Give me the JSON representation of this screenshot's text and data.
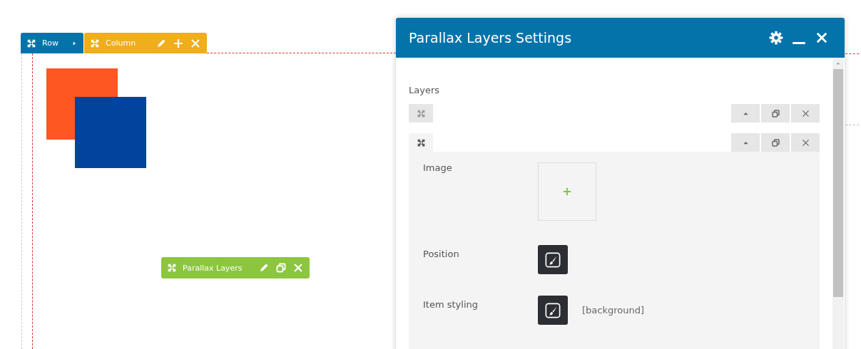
{
  "canvas": {
    "toolbars": [
      {
        "kind": "row",
        "label": "Row",
        "color": "#0473aa"
      },
      {
        "kind": "column",
        "label": "Column",
        "color": "#f0ad1c"
      },
      {
        "kind": "module",
        "label": "Parallax Layers",
        "color": "#8cc63e"
      }
    ],
    "shapes": [
      {
        "color": "#ff5722"
      },
      {
        "color": "#00449e"
      }
    ]
  },
  "dialog": {
    "title": "Parallax Layers Settings",
    "section_label": "Layers",
    "layers": [
      {
        "expanded": false
      },
      {
        "expanded": true,
        "fields": [
          {
            "kind": "image",
            "label": "Image"
          },
          {
            "kind": "style",
            "label": "Position"
          },
          {
            "kind": "style",
            "label": "Item styling",
            "value": "[background]"
          }
        ]
      }
    ]
  }
}
